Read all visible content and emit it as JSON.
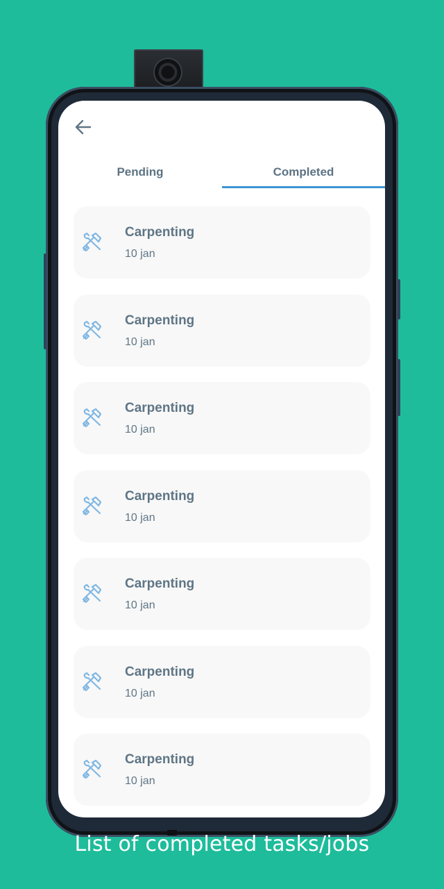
{
  "header": {
    "back_icon": "arrow-left-icon"
  },
  "tabs": [
    {
      "label": "Pending",
      "selected": false
    },
    {
      "label": "Completed",
      "selected": true
    }
  ],
  "colors": {
    "background": "#1ebc9b",
    "accent": "#3d94d3",
    "text": "#5f7585",
    "card": "#f8f8f8"
  },
  "tasks": [
    {
      "icon": "hammer-wrench-icon",
      "title": "Carpenting",
      "date": "10 jan"
    },
    {
      "icon": "hammer-wrench-icon",
      "title": "Carpenting",
      "date": "10 jan"
    },
    {
      "icon": "hammer-wrench-icon",
      "title": "Carpenting",
      "date": "10 jan"
    },
    {
      "icon": "hammer-wrench-icon",
      "title": "Carpenting",
      "date": "10 jan"
    },
    {
      "icon": "hammer-wrench-icon",
      "title": "Carpenting",
      "date": "10 jan"
    },
    {
      "icon": "hammer-wrench-icon",
      "title": "Carpenting",
      "date": "10 jan"
    },
    {
      "icon": "hammer-wrench-icon",
      "title": "Carpenting",
      "date": "10 jan"
    }
  ],
  "caption": "List of completed tasks/jobs"
}
